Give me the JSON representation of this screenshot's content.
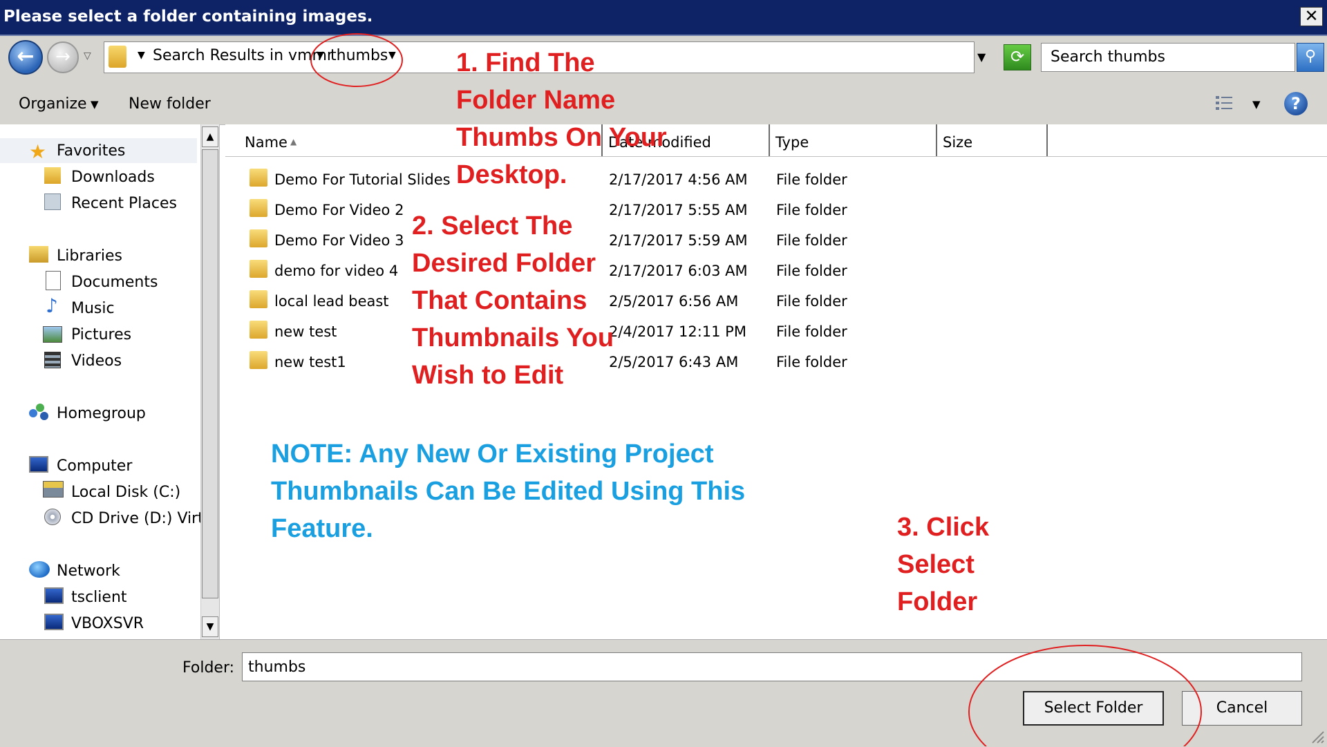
{
  "window": {
    "title": "Please select a folder containing images.",
    "close_glyph": "✕"
  },
  "address": {
    "crumbs": [
      "Search Results in vmmr",
      "thumbs"
    ],
    "search_placeholder": "Search thumbs"
  },
  "toolbar": {
    "organize": "Organize",
    "new_folder": "New folder",
    "help_glyph": "?"
  },
  "nav": {
    "groups": [
      {
        "label": "Favorites",
        "icon": "star-icon",
        "items": [
          {
            "label": "Downloads",
            "icon": "downloads-folder-icon"
          },
          {
            "label": "Recent Places",
            "icon": "recent-places-icon"
          }
        ]
      },
      {
        "label": "Libraries",
        "icon": "libraries-icon",
        "items": [
          {
            "label": "Documents",
            "icon": "documents-icon"
          },
          {
            "label": "Music",
            "icon": "music-icon"
          },
          {
            "label": "Pictures",
            "icon": "pictures-icon"
          },
          {
            "label": "Videos",
            "icon": "videos-icon"
          }
        ]
      },
      {
        "label": "Homegroup",
        "icon": "homegroup-icon",
        "items": []
      },
      {
        "label": "Computer",
        "icon": "computer-icon",
        "items": [
          {
            "label": "Local Disk (C:)",
            "icon": "local-disk-icon"
          },
          {
            "label": "CD Drive (D:) Virtu",
            "icon": "cd-drive-icon"
          }
        ]
      },
      {
        "label": "Network",
        "icon": "network-icon",
        "items": [
          {
            "label": "tsclient",
            "icon": "network-computer-icon"
          },
          {
            "label": "VBOXSVR",
            "icon": "network-computer-icon"
          }
        ]
      }
    ]
  },
  "columns": {
    "name": "Name",
    "date": "Date modified",
    "type": "Type",
    "size": "Size"
  },
  "files": [
    {
      "name": "Demo For Tutorial Slides",
      "date": "2/17/2017 4:56 AM",
      "type": "File folder"
    },
    {
      "name": "Demo For Video 2",
      "date": "2/17/2017 5:55 AM",
      "type": "File folder"
    },
    {
      "name": "Demo For Video 3",
      "date": "2/17/2017 5:59 AM",
      "type": "File folder"
    },
    {
      "name": "demo for video 4",
      "date": "2/17/2017 6:03 AM",
      "type": "File folder"
    },
    {
      "name": "local lead beast",
      "date": "2/5/2017 6:56 AM",
      "type": "File folder"
    },
    {
      "name": "new test",
      "date": "2/4/2017 12:11 PM",
      "type": "File folder"
    },
    {
      "name": "new test1",
      "date": "2/5/2017 6:43 AM",
      "type": "File folder"
    }
  ],
  "bottom": {
    "folder_label": "Folder:",
    "folder_value": "thumbs",
    "select_button": "Select Folder",
    "cancel_button": "Cancel"
  },
  "annotations": {
    "step1": [
      "1. Find The",
      "Folder Name",
      "Thumbs On Your",
      "Desktop."
    ],
    "step2": [
      "2. Select The",
      "Desired Folder",
      "That Contains",
      "Thumbnails You",
      "Wish to Edit"
    ],
    "note": [
      "NOTE: Any New Or Existing Project",
      "Thumbnails Can Be Edited Using This",
      "Feature."
    ],
    "step3": [
      "3. Click",
      "Select",
      "Folder"
    ]
  },
  "colors": {
    "title_bar": "#0e2266",
    "annotation_red": "#e02020",
    "annotation_blue": "#1aa0e0",
    "chrome": "#d7d5d0"
  }
}
